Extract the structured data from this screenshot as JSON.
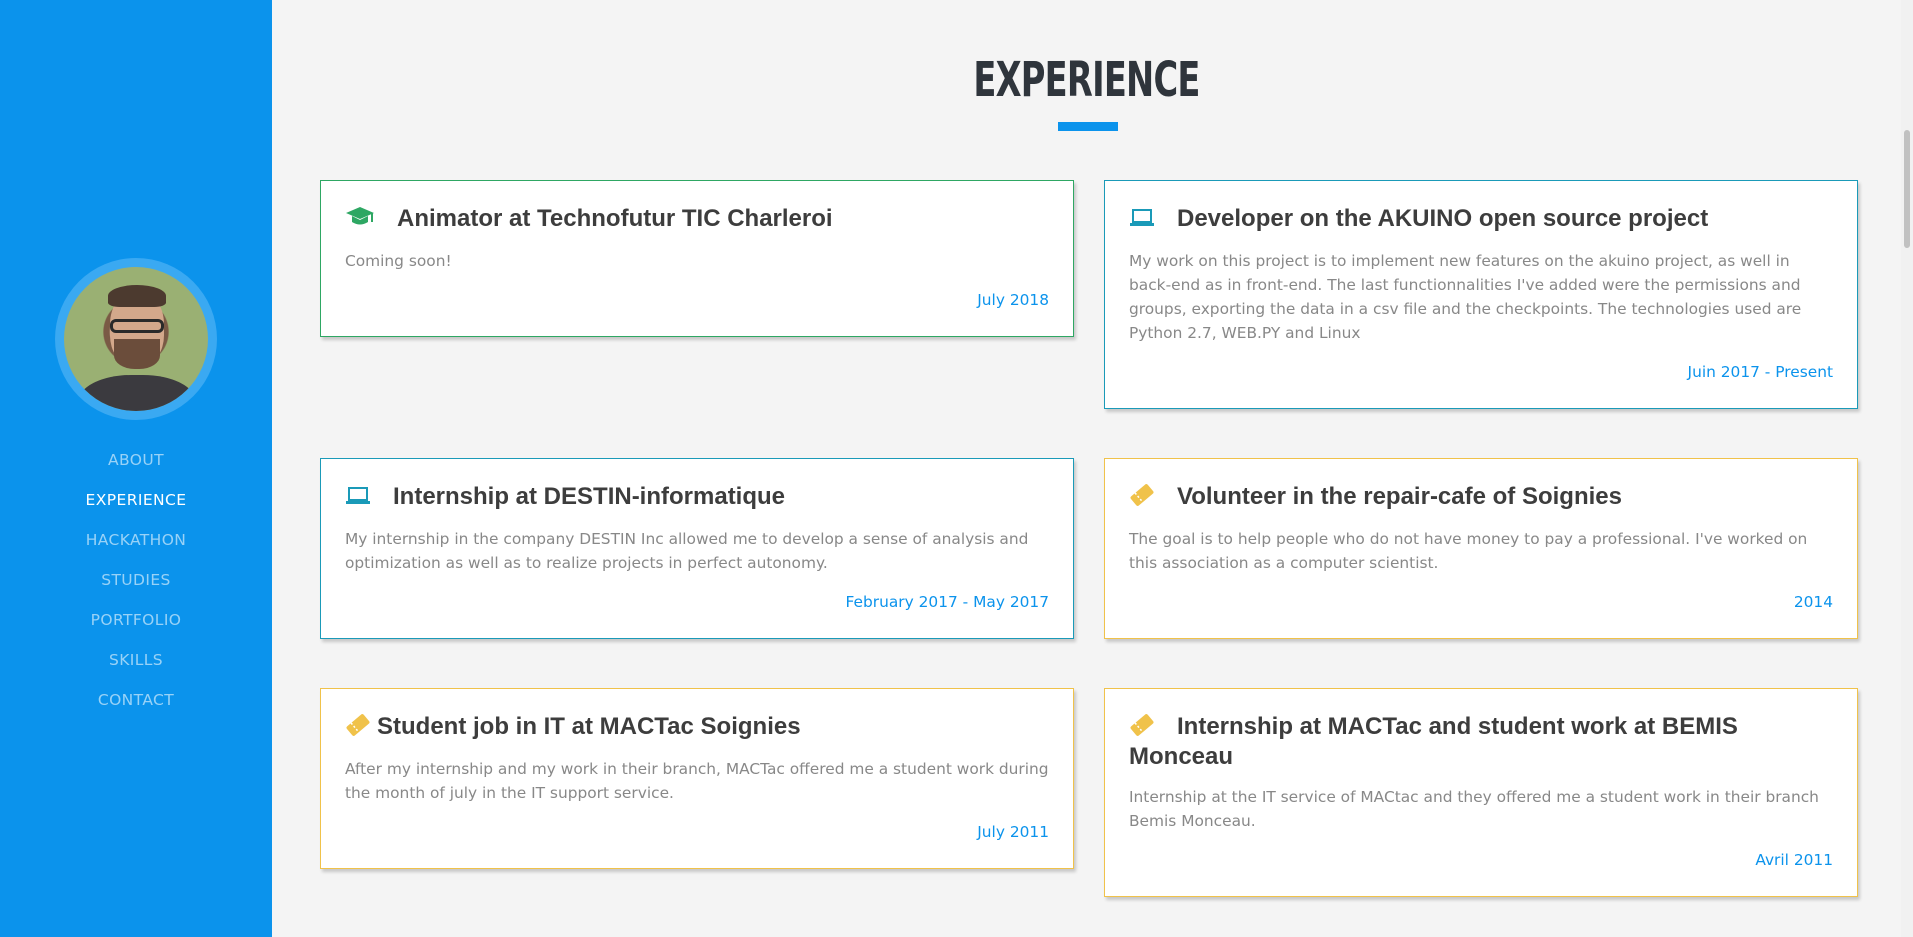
{
  "nav": {
    "items": [
      "ABOUT",
      "EXPERIENCE",
      "HACKATHON",
      "STUDIES",
      "PORTFOLIO",
      "SKILLS",
      "CONTACT"
    ],
    "active": "EXPERIENCE"
  },
  "section": {
    "title": "EXPERIENCE"
  },
  "colors": {
    "accent": "#0b93ec",
    "green": "#2ea763",
    "teal": "#1a9ab8",
    "yellow": "#f0c24a"
  },
  "cards": [
    {
      "icon": "graduation-cap-icon",
      "title": "Animator at Technofutur TIC Charleroi",
      "text": "Coming soon!",
      "date": "July 2018"
    },
    {
      "icon": "laptop-icon",
      "title": "Developer on the AKUINO open source project",
      "text": "My work on this project is to implement new features on the akuino project, as well in back-end as in front-end. The last functionnalities I've added were the permissions and groups, exporting the data in a csv file and the checkpoints. The technologies used are Python 2.7, WEB.PY and Linux",
      "date": "Juin 2017 - Present"
    },
    {
      "icon": "laptop-icon",
      "title": "Internship at DESTIN-informatique",
      "text": "My internship in the company DESTIN Inc allowed me to develop a sense of analysis and optimization as well as to realize projects in perfect autonomy.",
      "date": "February 2017 - May 2017"
    },
    {
      "icon": "ticket-icon",
      "title": "Volunteer in the repair-cafe of Soignies",
      "text": "The goal is to help people who do not have money to pay a professional. I've worked on this association as a computer scientist.",
      "date": "2014"
    },
    {
      "icon": "ticket-icon",
      "title": "Student job in IT at MACTac Soignies",
      "text": "After my internship and my work in their branch, MACTac offered me a student work during the month of july in the IT support service.",
      "date": "July 2011"
    },
    {
      "icon": "ticket-icon",
      "title": "Internship at MACTac and student work at BEMIS Monceau",
      "text": "Internship at the IT service of MACtac and they offered me a student work in their branch Bemis Monceau.",
      "date": "Avril 2011"
    }
  ]
}
